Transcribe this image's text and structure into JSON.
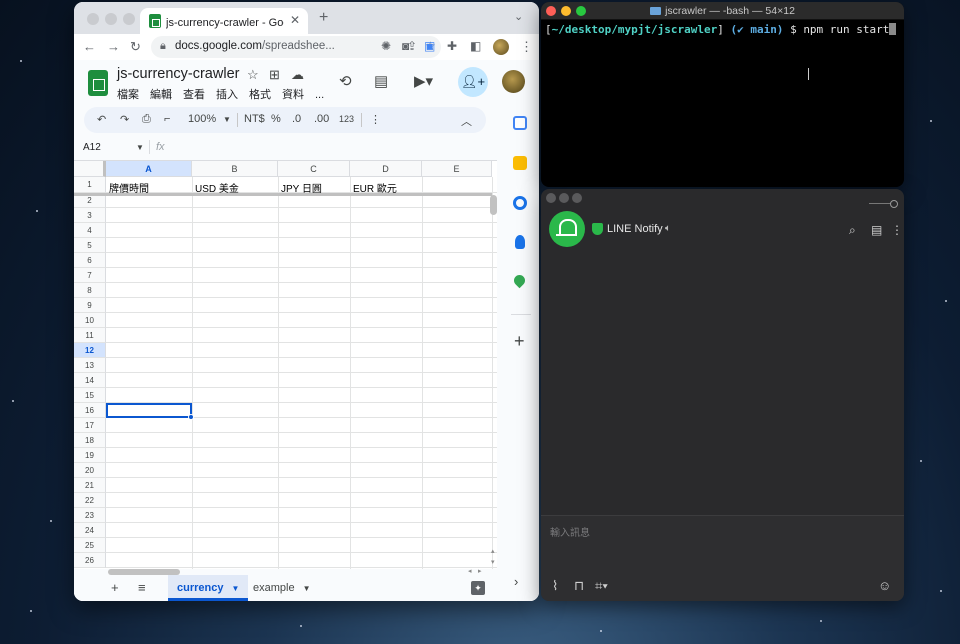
{
  "chrome": {
    "tab_title": "js-currency-crawler - Google 試算表",
    "tab_close": "✕",
    "new_tab": "+",
    "tab_menu": "⌄",
    "url_host": "docs.google.com",
    "url_path": "/spreadshee..."
  },
  "sheets": {
    "doc_title": "js-currency-crawler",
    "menu": [
      "檔案",
      "編輯",
      "查看",
      "插入",
      "格式",
      "資料",
      "..."
    ],
    "toolbar": {
      "zoom": "100%",
      "currency": "NT$",
      "percent": "%",
      "dec_decrease": ".0",
      "dec_increase": ".00",
      "number_format": "123"
    },
    "name_box": "A12",
    "fx": "fx",
    "columns": [
      "A",
      "B",
      "C",
      "D",
      "E"
    ],
    "selected_column": "A",
    "row_numbers": [
      "1",
      "2",
      "3",
      "4",
      "5",
      "6",
      "7",
      "8",
      "9",
      "10",
      "11",
      "12",
      "13",
      "14",
      "15",
      "16",
      "17",
      "18",
      "19",
      "20",
      "21",
      "22",
      "23",
      "24",
      "25",
      "26"
    ],
    "selected_row": "12",
    "header_row": [
      "牌價時間",
      "USD 美金",
      "JPY 日圓",
      "EUR 歐元",
      ""
    ],
    "sheet_tabs": [
      {
        "name": "currency",
        "active": true
      },
      {
        "name": "example",
        "active": false
      }
    ]
  },
  "terminal": {
    "title": "jscrawler — -bash — 54×12",
    "prompt_open": "[",
    "prompt_path": "~/desktop/mypjt/jscrawler",
    "prompt_close": "]",
    "prompt_branch": "(✔ main)",
    "prompt_symbol": "$",
    "command": "npm run start"
  },
  "line": {
    "chat_name": "LINE Notify",
    "input_placeholder": "輸入訊息"
  },
  "colors": {
    "sheets_green": "#1e8e3e",
    "sheets_blue": "#0b57d0",
    "line_green": "#2ab84a",
    "terminal_path": "#4fd1c5"
  }
}
